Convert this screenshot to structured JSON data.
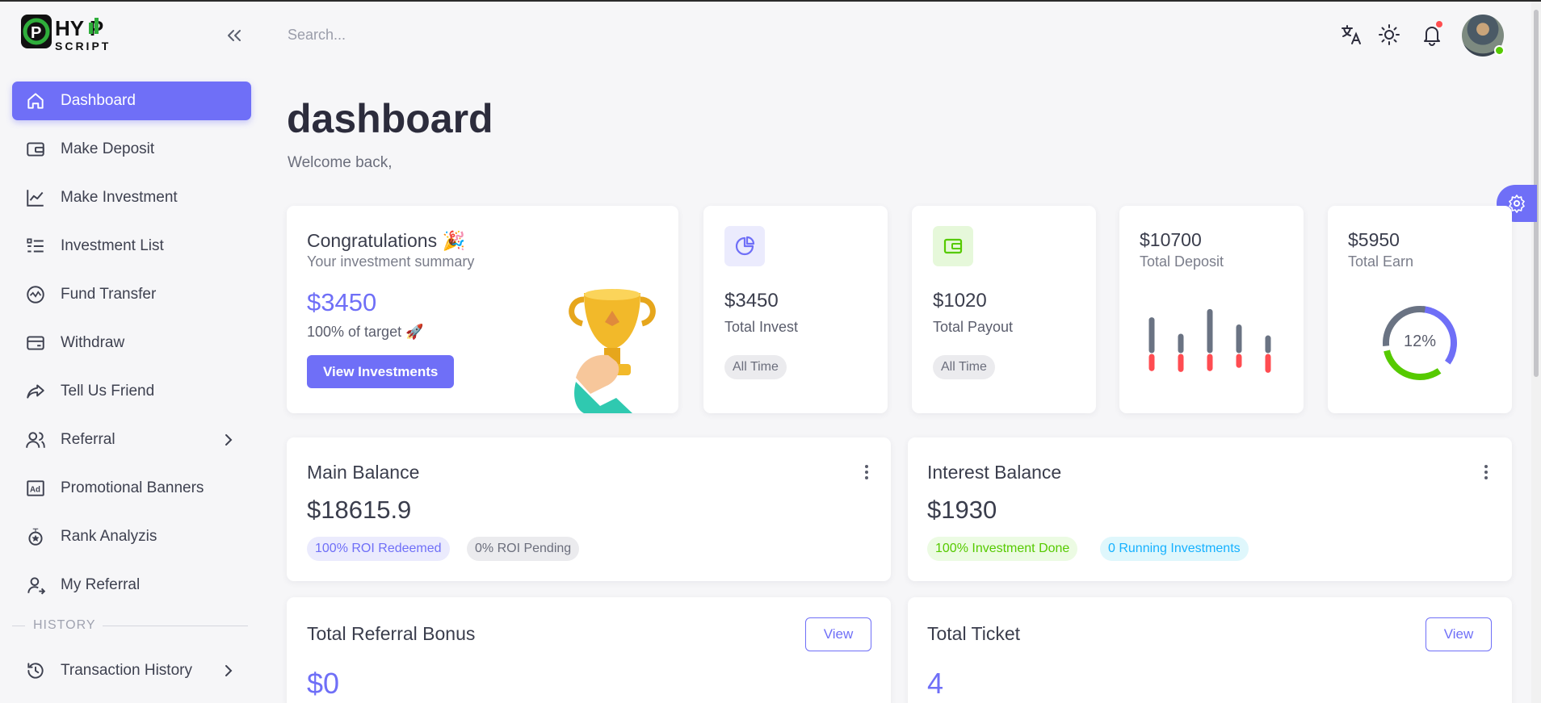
{
  "brand": {
    "logo_text_top": "HY P",
    "logo_text_bottom": "SCRIPT"
  },
  "search": {
    "placeholder": "Search..."
  },
  "sidebar": {
    "items": [
      {
        "label": "Dashboard",
        "icon": "home-icon",
        "active": true
      },
      {
        "label": "Make Deposit",
        "icon": "wallet-icon"
      },
      {
        "label": "Make Investment",
        "icon": "chart-line-icon"
      },
      {
        "label": "Investment List",
        "icon": "list-icon"
      },
      {
        "label": "Fund Transfer",
        "icon": "activity-icon"
      },
      {
        "label": "Withdraw",
        "icon": "card-icon"
      },
      {
        "label": "Tell Us Friend",
        "icon": "share-icon"
      },
      {
        "label": "Referral",
        "icon": "users-icon",
        "has_submenu": true
      },
      {
        "label": "Promotional Banners",
        "icon": "ad-icon"
      },
      {
        "label": "Rank Analyzis",
        "icon": "medal-icon"
      },
      {
        "label": "My Referral",
        "icon": "user-arrow-icon"
      }
    ],
    "section_history": "HISTORY",
    "history_items": [
      {
        "label": "Transaction History",
        "icon": "history-icon",
        "has_submenu": true
      }
    ]
  },
  "page": {
    "title": "dashboard",
    "subtitle": "Welcome back,"
  },
  "congrats": {
    "title": "Congratulations 🎉",
    "subtitle": "Your investment summary",
    "amount": "$3450",
    "target": "100% of target 🚀",
    "button": "View Investments"
  },
  "stats": [
    {
      "amount": "$3450",
      "label": "Total Invest",
      "badge": "All Time",
      "icon": "pie-chart-icon",
      "color": "#6f6ff7"
    },
    {
      "amount": "$1020",
      "label": "Total Payout",
      "badge": "All Time",
      "icon": "wallet-icon",
      "color": "#56ca00"
    }
  ],
  "total_deposit": {
    "amount": "$10700",
    "label": "Total Deposit",
    "bars": [
      {
        "up": 0.55,
        "down": 0.28
      },
      {
        "up": 0.25,
        "down": 0.3
      },
      {
        "up": 0.7,
        "down": 0.28
      },
      {
        "up": 0.42,
        "down": 0.2
      },
      {
        "up": 0.22,
        "down": 0.32
      }
    ]
  },
  "total_earn": {
    "amount": "$5950",
    "label": "Total Earn",
    "percent_label": "12%"
  },
  "main_balance": {
    "title": "Main Balance",
    "amount": "$18615.9",
    "pill_1": "100% ROI Redeemed",
    "pill_2": "0% ROI Pending"
  },
  "interest_balance": {
    "title": "Interest Balance",
    "amount": "$1930",
    "pill_1": "100% Investment Done",
    "pill_2": "0 Running Investments"
  },
  "referral_bonus": {
    "title": "Total Referral Bonus",
    "button": "View",
    "amount": "$0"
  },
  "total_ticket": {
    "title": "Total Ticket",
    "button": "View",
    "amount": "4"
  },
  "colors": {
    "primary": "#6f6ff7",
    "success": "#56ca00",
    "error": "#ff4c51",
    "info": "#16b1ff"
  }
}
